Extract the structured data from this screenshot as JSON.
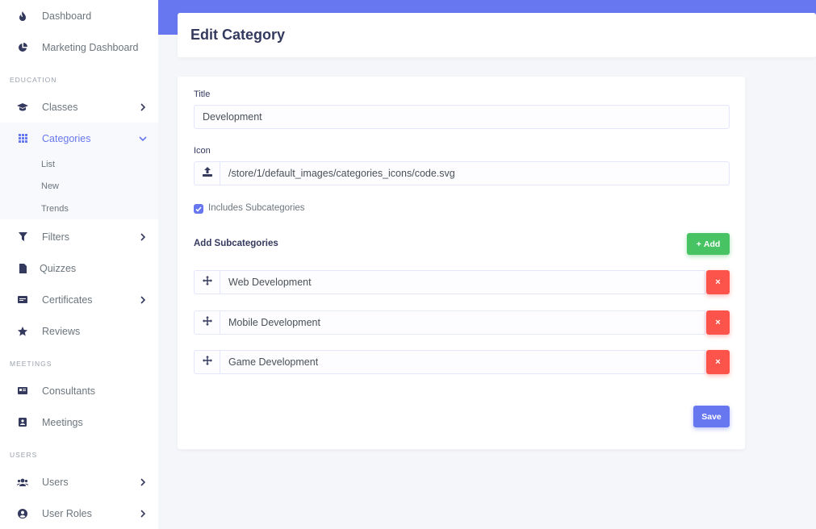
{
  "colors": {
    "primary": "#6777ef",
    "success": "#47c363",
    "danger": "#fc544b",
    "sidebar_text": "#6c757d",
    "heading": "#34395e"
  },
  "sidebar": {
    "items": [
      {
        "label": "Dashboard",
        "icon": "fire-icon"
      },
      {
        "label": "Marketing Dashboard",
        "icon": "pie-chart-icon"
      },
      {
        "label": "Classes",
        "icon": "graduation-cap-icon"
      },
      {
        "label": "Categories",
        "icon": "grid-icon"
      },
      {
        "label": "Filters",
        "icon": "filter-icon"
      },
      {
        "label": "Quizzes",
        "icon": "file-icon"
      },
      {
        "label": "Certificates",
        "icon": "certificate-icon"
      },
      {
        "label": "Reviews",
        "icon": "star-icon"
      },
      {
        "label": "Consultants",
        "icon": "id-card-icon"
      },
      {
        "label": "Meetings",
        "icon": "contact-icon"
      },
      {
        "label": "Users",
        "icon": "users-icon"
      },
      {
        "label": "User Roles",
        "icon": "user-circle-icon"
      }
    ],
    "sections": [
      "EDUCATION",
      "MEETINGS",
      "USERS"
    ],
    "categories_submenu": [
      "List",
      "New",
      "Trends"
    ]
  },
  "header": {
    "title": "Edit Category"
  },
  "form": {
    "title_label": "Title",
    "title_value": "Development",
    "icon_label": "Icon",
    "icon_value": "/store/1/default_images/categories_icons/code.svg",
    "includes_subcategories_label": "Includes Subcategories",
    "includes_subcategories_checked": true,
    "add_subcategories_label": "Add Subcategories",
    "add_button_label": "Add",
    "add_button_icon": "+",
    "remove_icon": "×",
    "subcategories": [
      "Web Development",
      "Mobile Development",
      "Game Development"
    ],
    "save_label": "Save"
  }
}
